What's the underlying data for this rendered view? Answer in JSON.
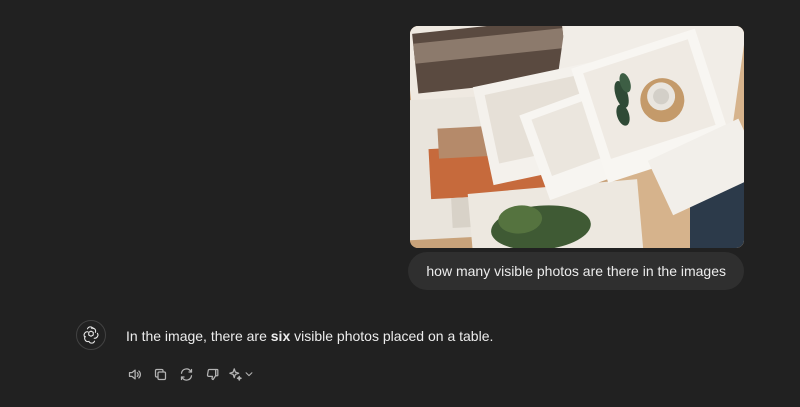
{
  "conversation": {
    "user": {
      "attachment": {
        "kind": "image",
        "alt": ""
      },
      "message": "how many visible photos are there in the images"
    },
    "assistant": {
      "text_before": "In the image, there are ",
      "text_bold": "six",
      "text_after": " visible photos placed on a table.",
      "actions": [
        {
          "id": "read-aloud",
          "icon": "speaker-icon"
        },
        {
          "id": "copy",
          "icon": "copy-icon"
        },
        {
          "id": "regenerate",
          "icon": "refresh-icon"
        },
        {
          "id": "bad-response",
          "icon": "thumbs-down-icon"
        },
        {
          "id": "change-model",
          "icon": "sparkle-icon"
        }
      ]
    }
  },
  "colors": {
    "background": "#212121",
    "bubble": "#2f2f2f",
    "text": "#ececec",
    "icon": "#b4b4b4"
  }
}
